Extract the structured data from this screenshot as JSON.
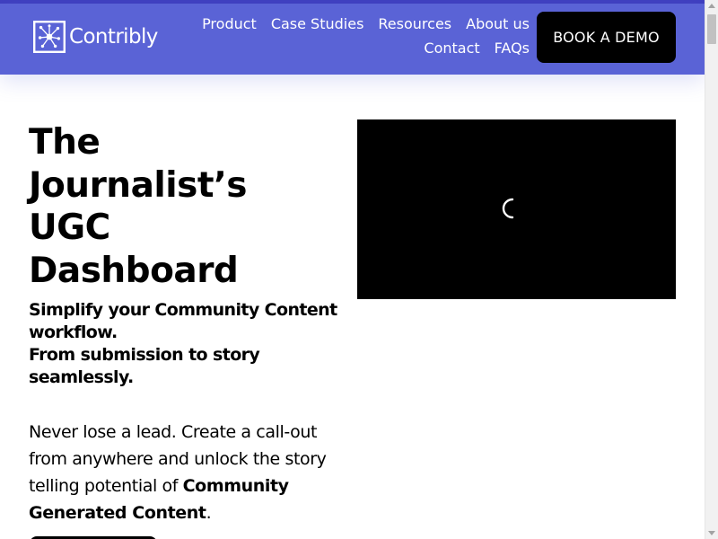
{
  "brand": {
    "name": "Contribly",
    "header_color": "#5a63d6",
    "accent_color": "#3f3fbf"
  },
  "nav": {
    "row1": [
      "Product",
      "Case Studies",
      "Resources",
      "About us"
    ],
    "row2": [
      "Contact",
      "FAQs"
    ],
    "cta_label": "BOOK A DEMO"
  },
  "hero": {
    "title_lines": [
      "The",
      "Journalist’s",
      "UGC",
      "Dashboard"
    ],
    "subtitle_lines": [
      "Simplify your Community Content workflow.",
      "From submission to story seamlessly."
    ],
    "description_prefix": "Never lose a lead. Create a call-out from anywhere and unlock the story telling potential of ",
    "description_bold": "Community Generated Content",
    "description_suffix": "."
  },
  "video": {
    "state": "loading",
    "icon": "loading-spinner-icon"
  }
}
